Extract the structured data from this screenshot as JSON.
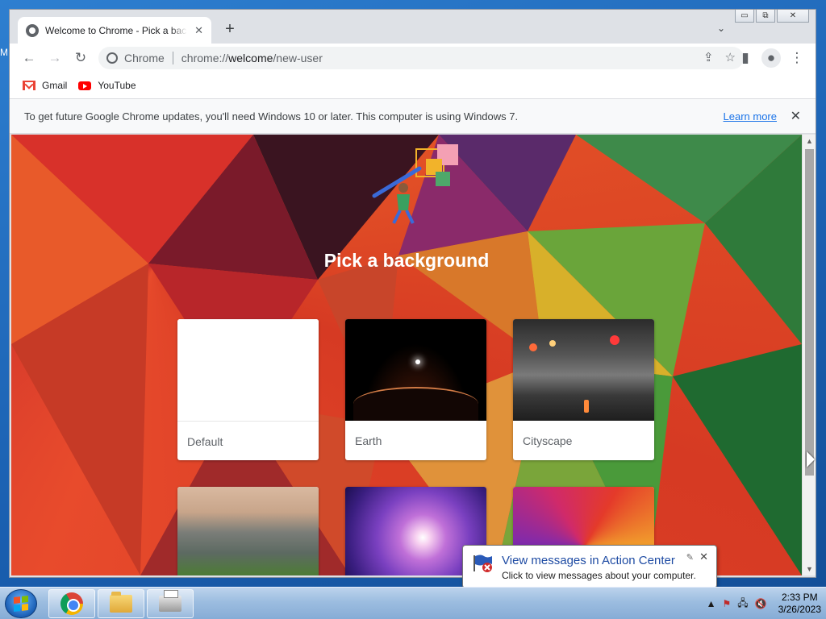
{
  "desktop": {
    "edge_label": "M"
  },
  "tab": {
    "title": "Welcome to Chrome - Pick a background",
    "close": "✕"
  },
  "tabstrip": {
    "new_tab": "+",
    "tab_search": "⌄"
  },
  "window_controls": {
    "minimize": "▭",
    "maximize": "⧉",
    "close": "✕"
  },
  "toolbar": {
    "back": "←",
    "forward": "→",
    "reload": "↻",
    "omnibox": {
      "chip": "Chrome",
      "url_prefix": "chrome://",
      "url_host": "welcome",
      "url_path": "/new-user"
    },
    "share": "⇪",
    "bookmark_star": "☆",
    "side_panel": "▮",
    "profile": "●",
    "menu": "⋮"
  },
  "bookmarks": [
    {
      "label": "Gmail",
      "icon": "gmail-icon"
    },
    {
      "label": "YouTube",
      "icon": "youtube-icon"
    }
  ],
  "infobar": {
    "message": "To get future Google Chrome updates, you'll need Windows 10 or later. This computer is using Windows 7.",
    "learn_more": "Learn more",
    "close": "✕"
  },
  "welcome": {
    "heading": "Pick a background",
    "backgrounds": [
      {
        "label": "Default"
      },
      {
        "label": "Earth"
      },
      {
        "label": "Cityscape"
      },
      {
        "label": ""
      },
      {
        "label": ""
      },
      {
        "label": ""
      }
    ]
  },
  "scrollbar": {
    "up": "▲",
    "down": "▼"
  },
  "notification": {
    "title": "View messages in Action Center",
    "text": "Click to view messages about your computer.",
    "pin": "✎",
    "close": "✕"
  },
  "taskbar": {
    "apps": [
      {
        "name": "chrome"
      },
      {
        "name": "windows-explorer"
      },
      {
        "name": "printer"
      }
    ],
    "tray": {
      "show_hidden": "▲",
      "network": "🖧",
      "volume": "🔇",
      "action_center": "⚑"
    },
    "clock": {
      "time": "2:33 PM",
      "date": "3/26/2023"
    }
  }
}
